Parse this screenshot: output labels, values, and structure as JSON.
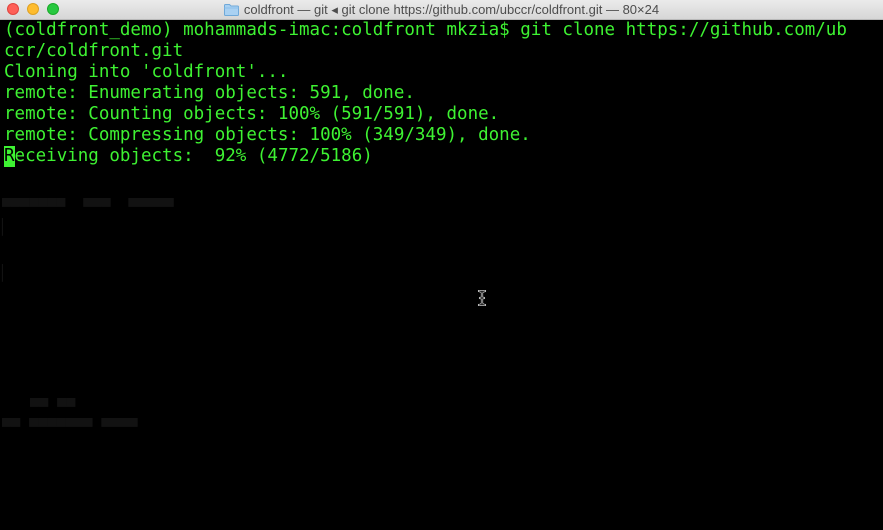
{
  "window": {
    "title": "coldfront — git ◂ git clone https://github.com/ubccr/coldfront.git — 80×24"
  },
  "terminal": {
    "text_color": "#3ef232",
    "background_color": "#000000",
    "lines": [
      "(coldfront_demo) mohammads-imac:coldfront mkzia$ git clone https://github.com/ub",
      "ccr/coldfront.git",
      "Cloning into 'coldfront'...",
      "remote: Enumerating objects: 591, done.",
      "remote: Counting objects: 100% (591/591), done.",
      "remote: Compressing objects: 100% (349/349), done."
    ],
    "current_line": {
      "cursor_char": "R",
      "rest": "eceiving objects:  92% (4772/5186)"
    }
  },
  "icons": {
    "folder": "folder-icon",
    "cursor": "text-ibeam-cursor-icon"
  }
}
